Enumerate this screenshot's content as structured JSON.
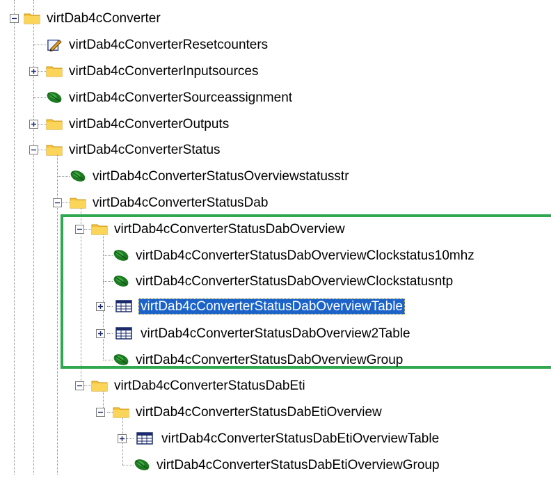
{
  "tree": {
    "nodes": [
      {
        "label": "virtDab4cConverter",
        "icon": "folder-icon",
        "expander": "minus"
      },
      {
        "label": "virtDab4cConverterResetcounters",
        "icon": "pen-icon"
      },
      {
        "label": "virtDab4cConverterInputsources",
        "icon": "folder-icon",
        "expander": "plus"
      },
      {
        "label": "virtDab4cConverterSourceassignment",
        "icon": "leaf-icon"
      },
      {
        "label": "virtDab4cConverterOutputs",
        "icon": "folder-icon",
        "expander": "plus"
      },
      {
        "label": "virtDab4cConverterStatus",
        "icon": "folder-icon",
        "expander": "minus"
      },
      {
        "label": "virtDab4cConverterStatusOverviewstatusstr",
        "icon": "leaf-icon"
      },
      {
        "label": "virtDab4cConverterStatusDab",
        "icon": "folder-icon",
        "expander": "minus"
      },
      {
        "label": "virtDab4cConverterStatusDabOverview",
        "icon": "folder-icon",
        "expander": "minus"
      },
      {
        "label": "virtDab4cConverterStatusDabOverviewClockstatus10mhz",
        "icon": "leaf-icon"
      },
      {
        "label": "virtDab4cConverterStatusDabOverviewClockstatusntp",
        "icon": "leaf-icon"
      },
      {
        "label": "virtDab4cConverterStatusDabOverviewTable",
        "icon": "table-icon",
        "expander": "plus",
        "selected": true
      },
      {
        "label": "virtDab4cConverterStatusDabOverview2Table",
        "icon": "table-icon",
        "expander": "plus"
      },
      {
        "label": "virtDab4cConverterStatusDabOverviewGroup",
        "icon": "leaf-icon"
      },
      {
        "label": "virtDab4cConverterStatusDabEti",
        "icon": "folder-icon",
        "expander": "minus"
      },
      {
        "label": "virtDab4cConverterStatusDabEtiOverview",
        "icon": "folder-icon",
        "expander": "minus"
      },
      {
        "label": "virtDab4cConverterStatusDabEtiOverviewTable",
        "icon": "table-icon",
        "expander": "plus"
      },
      {
        "label": "virtDab4cConverterStatusDabEtiOverviewGroup",
        "icon": "leaf-icon"
      }
    ]
  },
  "colors": {
    "selection": "#1b63c9",
    "highlight_box": "#2fa84f",
    "folder": "#f6c33a",
    "leaf": "#1e7a22"
  }
}
